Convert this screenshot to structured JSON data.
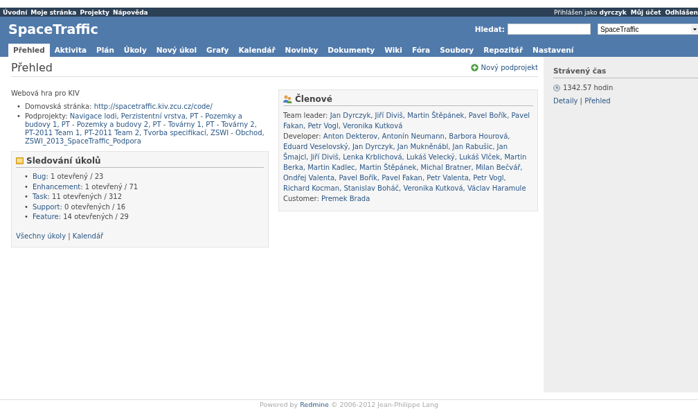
{
  "top_menu": {
    "items": [
      "Úvodní",
      "Moje stránka",
      "Projekty",
      "Nápověda"
    ],
    "logged_prefix": "Přihlášen jako",
    "user": "dyrczyk",
    "account_links": [
      "Můj účet",
      "Odhlášen"
    ]
  },
  "header": {
    "title": "SpaceTraffic",
    "search_label": "Hledat:",
    "project_select": "SpaceTraffic"
  },
  "tabs": [
    {
      "label": "Přehled",
      "selected": true
    },
    {
      "label": "Aktivita",
      "selected": false
    },
    {
      "label": "Plán",
      "selected": false
    },
    {
      "label": "Úkoly",
      "selected": false
    },
    {
      "label": "Nový úkol",
      "selected": false
    },
    {
      "label": "Grafy",
      "selected": false
    },
    {
      "label": "Kalendář",
      "selected": false
    },
    {
      "label": "Novinky",
      "selected": false
    },
    {
      "label": "Dokumenty",
      "selected": false
    },
    {
      "label": "Wiki",
      "selected": false
    },
    {
      "label": "Fóra",
      "selected": false
    },
    {
      "label": "Soubory",
      "selected": false
    },
    {
      "label": "Repozitář",
      "selected": false
    },
    {
      "label": "Nastavení",
      "selected": false
    }
  ],
  "page_title": "Přehled",
  "new_subproject": "Nový podprojekt",
  "description": "Webová hra pro KIV",
  "info": [
    {
      "marker": "•",
      "heading": "Domovská stránka:",
      "links": "http://spacetraffic.kiv.zcu.cz/code/"
    },
    {
      "marker": "•",
      "heading": "Podprojekty:",
      "links": "Navigace lodi, Perzistentní vrstva, PT - Pozemky a budovy 1, PT - Pozemky a budovy 2, PT - Továrny 1, PT - Továrny 2, PT-2011 Team 1, PT-2011 Team 2, Tvorba specifikací, ZSWI - Obchod, ZSWI_2013_SpaceTraffic_Podpora"
    }
  ],
  "issues": {
    "title": "Sledování úkolů",
    "trackers": [
      {
        "marker": "•",
        "name": "Bug",
        "counts": ": 1 otevřený / 23"
      },
      {
        "marker": "•",
        "name": "Enhancement",
        "counts": ": 1 otevřený / 71"
      },
      {
        "marker": "•",
        "name": "Task",
        "counts": ": 11 otevřených / 312"
      },
      {
        "marker": "•",
        "name": "Support",
        "counts": ": 0 otevřených / 16"
      },
      {
        "marker": "•",
        "name": "Feature",
        "counts": ": 14 otevřených / 29"
      }
    ],
    "links": [
      "Všechny úkoly",
      "Kalendář"
    ],
    "separator": "|"
  },
  "members": {
    "title": "Členové",
    "roles": [
      {
        "role": "Team leader:",
        "names": "Jan Dyrczyk, Jiří Diviš, Martin Štěpánek, Pavel Bořík, Pavel Fakan, Petr Vogl, Veronika Kutková"
      },
      {
        "role": "Developer:",
        "names": "Anton Dekterov, Antonín Neumann, Barbora Hourová, Eduard Veselovský, Jan Dyrczyk, Jan Mukněnábl, Jan Rabušic, Jan Šmajcl, Jiří Diviš, Lenka Krblichová, Lukáš Velecký, Lukáš Vlček, Martin Berka, Martin Kadlec, Martin Štěpánek, Michal Bratner, Milan Bečvář, Ondřej Valenta, Pavel Bořík, Pavel Fakan, Petr Valenta, Petr Vogl, Richard Kocman, Stanislav Boháč, Veronika Kutková, Václav Haramule"
      },
      {
        "role": "Customer:",
        "names": "Premek Brada"
      }
    ]
  },
  "sidebar": {
    "title": "Strávený čas",
    "time": "1342.57 hodin",
    "links": [
      "Detaily",
      "Přehled"
    ],
    "separator": "|"
  },
  "footer": {
    "prefix": "Powered by",
    "link": "Redmine",
    "suffix": "© 2006-2012 Jean-Philippe Lang"
  }
}
